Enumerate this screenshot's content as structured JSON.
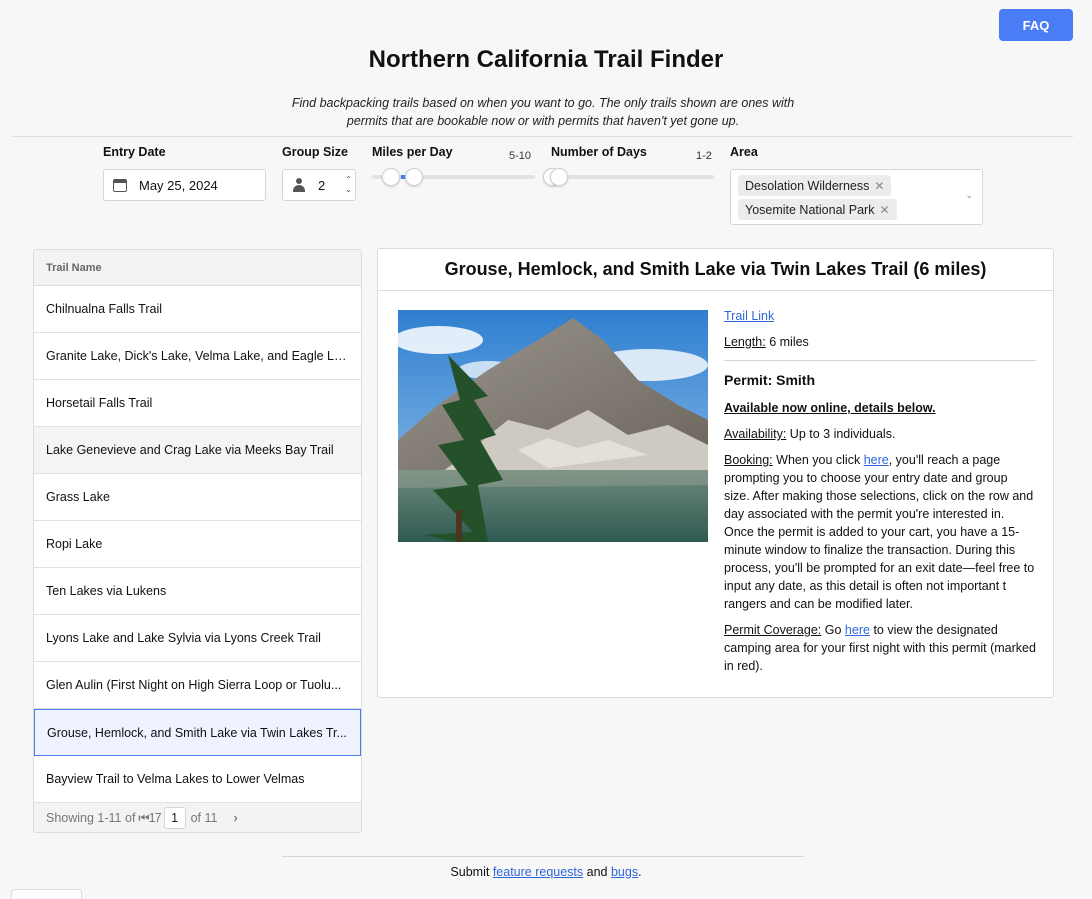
{
  "header": {
    "faq_label": "FAQ",
    "title": "Northern California Trail Finder",
    "subtitle_line1": "Find backpacking trails based on when you want to go. The only trails shown are ones with",
    "subtitle_line2": "permits that are bookable now or with permits that haven't yet gone up."
  },
  "filters": {
    "entry_date": {
      "label": "Entry Date",
      "value": "May 25, 2024",
      "icon": "calendar-icon"
    },
    "group_size": {
      "label": "Group Size",
      "value": "2",
      "icon": "person-icon"
    },
    "miles_per_day": {
      "label": "Miles per Day",
      "range_text": "5-10",
      "low": 5,
      "high": 10
    },
    "number_of_days": {
      "label": "Number of Days",
      "range_text": "1-2",
      "low": 1,
      "high": 2
    },
    "area": {
      "label": "Area",
      "selected": [
        "Desolation Wilderness",
        "Yosemite National Park"
      ]
    }
  },
  "trail_list": {
    "header": "Trail Name",
    "rows": [
      "Chilnualna Falls Trail",
      "Granite Lake, Dick's Lake, Velma Lake, and Eagle La...",
      "Horsetail Falls Trail",
      "Lake Genevieve and Crag Lake via Meeks Bay Trail",
      "Grass Lake",
      "Ropi Lake",
      "Ten Lakes via Lukens",
      "Lyons Lake and Lake Sylvia via Lyons Creek Trail",
      "Glen Aulin (First Night on High Sierra Loop or Tuolu...",
      "Grouse, Hemlock, and Smith Lake via Twin Lakes Tr...",
      "Bayview Trail to Velma Lakes to Lower Velmas"
    ],
    "selected_index": 9,
    "hover_index": 3,
    "footer": {
      "showing": "Showing 1-11 of 11",
      "prev_glyphs": "⟨⟨ ⟨",
      "page": "1",
      "of_pages": "of 11",
      "next_glyph": "›"
    }
  },
  "detail": {
    "title": "Grouse, Hemlock, and Smith Lake via Twin Lakes Trail (6 miles)",
    "trail_link": "Trail Link",
    "length_label": "Length:",
    "length_value": "6 miles",
    "permit_title": "Permit: Smith",
    "available_text": "Available now online, details below.",
    "availability_label": "Availability:",
    "availability_value": "Up to 3 individuals.",
    "booking_label": "Booking:",
    "booking_pre": "When you click",
    "booking_link": "here",
    "booking_post": ", you'll reach a page prompting you to choose your entry date and group size. After making those selections, click on the row and day associated with the permit you're interested in. Once the permit is added to your cart, you have a 15-minute window to finalize the transaction. During this process, you'll be prompted for an exit date—feel free to input any date, as this detail is often not important t rangers and can be modified later.",
    "coverage_label": "Permit Coverage:",
    "coverage_pre": "Go",
    "coverage_link": "here",
    "coverage_post": "to view the designated camping area for your first night with this permit (marked in red)."
  },
  "footer": {
    "pre": "Submit",
    "link1": "feature requests",
    "mid": "and",
    "link2": "bugs",
    "post": "."
  },
  "colors": {
    "accent": "#4a7cf6",
    "link": "#2f67d8"
  }
}
